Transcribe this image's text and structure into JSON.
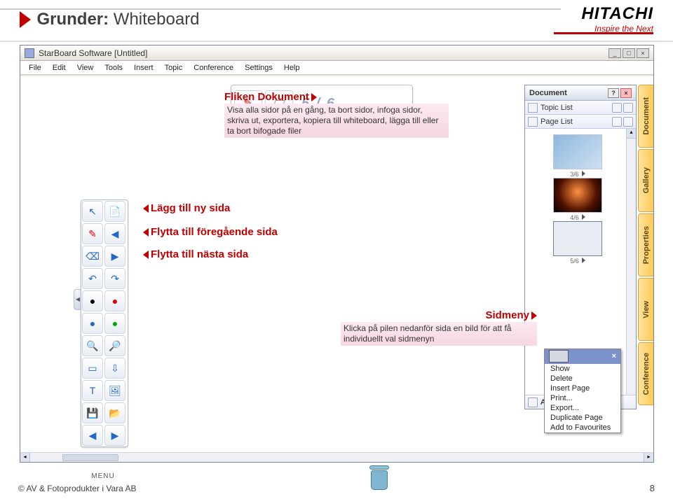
{
  "slide": {
    "title_prefix": "Grunder:",
    "title": "Whiteboard",
    "brand_name": "HITACHI",
    "brand_tag": "Inspire the Next"
  },
  "app": {
    "title": "StarBoard Software [Untitled]",
    "menus": [
      "File",
      "Edit",
      "View",
      "Tools",
      "Insert",
      "Topic",
      "Conference",
      "Settings",
      "Help"
    ],
    "page_counter": "5 / 6",
    "menu_label": "MENU"
  },
  "docpanel": {
    "header": "Document",
    "topic_list": "Topic List",
    "page_list": "Page List",
    "attached": "Attached File List",
    "thumbs": [
      {
        "label": "3/6"
      },
      {
        "label": "4/6"
      },
      {
        "label": "5/6"
      }
    ]
  },
  "vtabs": [
    "Document",
    "Gallery",
    "Properties",
    "View",
    "Conference"
  ],
  "callouts": {
    "fliken_title": "Fliken Dokument",
    "fliken_body": "Visa alla sidor på en gång, ta bort sidor, infoga sidor, skriva ut, exportera, kopiera till whiteboard, lägga till eller ta bort bifogade filer",
    "add_page": "Lägg till ny sida",
    "prev_page": "Flytta till föregående sida",
    "next_page": "Flytta till nästa sida",
    "sidmeny_title": "Sidmeny",
    "sidmeny_body": "Klicka på pilen nedanför sida en bild för att få individuellt val sidmenyn"
  },
  "context_menu": [
    "Show",
    "Delete",
    "Insert Page",
    "Print...",
    "Export...",
    "Duplicate Page",
    "Add to Favourites"
  ],
  "footer": {
    "copyright": "© AV & Fotoprodukter i Vara AB",
    "page_num": "8"
  }
}
